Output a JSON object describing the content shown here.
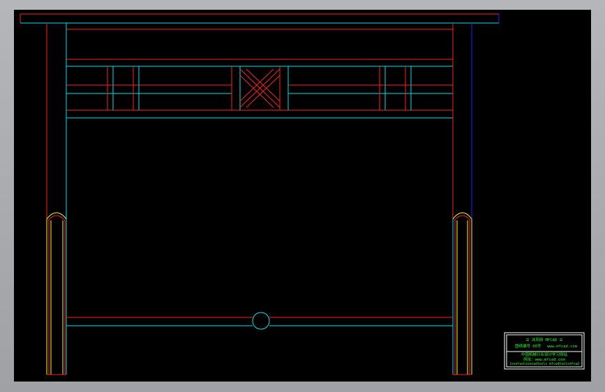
{
  "viewport": {
    "background": "#000000",
    "frame_color": "#a7a9ad"
  },
  "colors": {
    "red": "#ff2020",
    "cyan": "#00e5ee",
    "yellow": "#ffff00",
    "blue": "#2020ff",
    "green": "#22ff22",
    "white": "#ffffff"
  },
  "title_block": {
    "line1": "☰ 沐风网 MFCAD ☰",
    "line2a": "图纸编号 00号",
    "line2b": "www.mfcad.com",
    "line3": "中国机械行业设计学习网站",
    "line4": "网址：www.mfcad.com",
    "line5": "lovefashioncadtools  mfcadtoolsmfcad"
  }
}
